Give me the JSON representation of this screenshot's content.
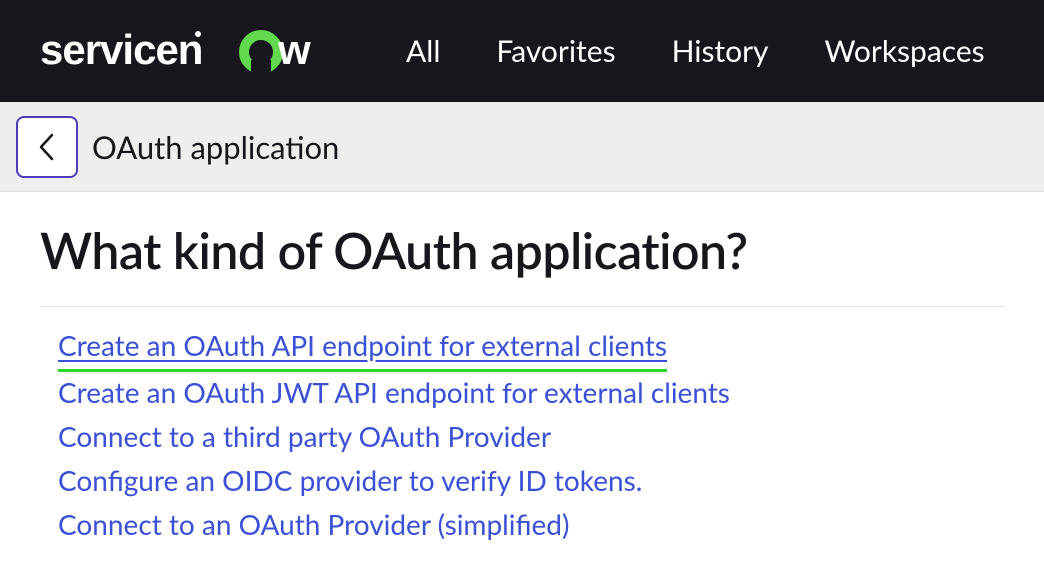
{
  "header": {
    "logo_text": "servicenow",
    "nav": [
      {
        "label": "All"
      },
      {
        "label": "Favorites"
      },
      {
        "label": "History"
      },
      {
        "label": "Workspaces"
      }
    ]
  },
  "breadcrumb": {
    "title": "OAuth application"
  },
  "main": {
    "heading": "What kind of OAuth application?",
    "options": [
      {
        "label": "Create an OAuth API endpoint for external clients",
        "highlighted": true
      },
      {
        "label": "Create an OAuth JWT API endpoint for external clients",
        "highlighted": false
      },
      {
        "label": "Connect to a third party OAuth Provider",
        "highlighted": false
      },
      {
        "label": "Configure an OIDC provider to verify ID tokens.",
        "highlighted": false
      },
      {
        "label": "Connect to an OAuth Provider (simplified)",
        "highlighted": false
      }
    ]
  }
}
